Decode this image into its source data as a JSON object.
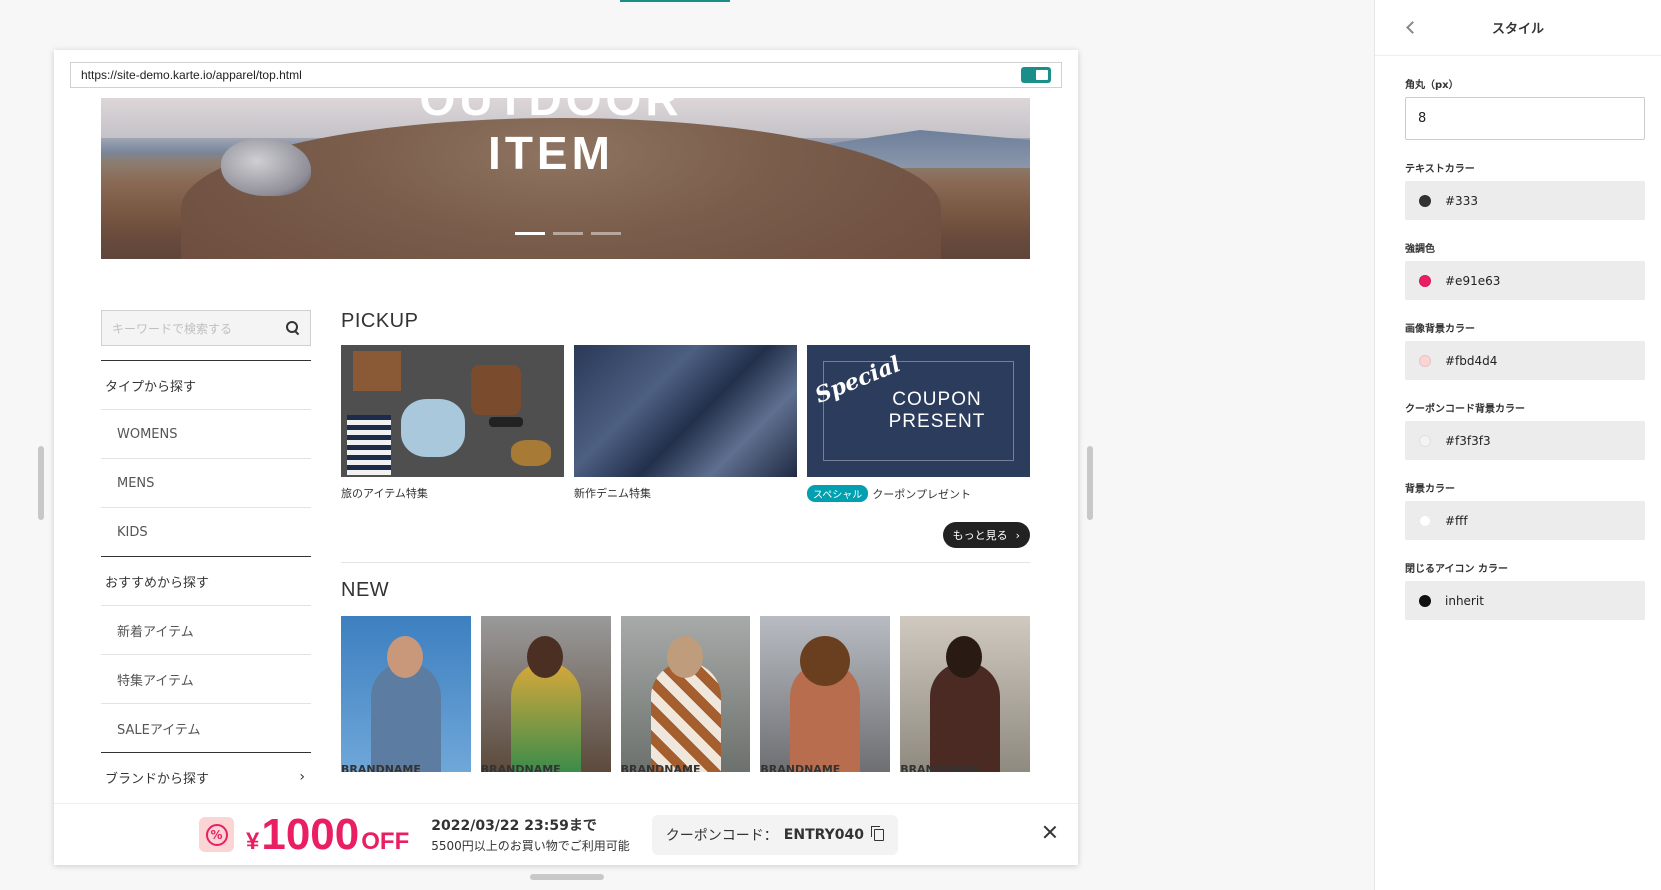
{
  "preview": {
    "url": "https://site-demo.karte.io/apparel/top.html",
    "hero_title": "OUTDOOR ITEM"
  },
  "sidebar": {
    "search_placeholder": "キーワードで検索する",
    "items": [
      {
        "label": "タイプから探す",
        "type": "head"
      },
      {
        "label": "WOMENS",
        "type": "sub"
      },
      {
        "label": "MENS",
        "type": "sub"
      },
      {
        "label": "KIDS",
        "type": "sub"
      },
      {
        "label": "おすすめから探す",
        "type": "head"
      },
      {
        "label": "新着アイテム",
        "type": "sub"
      },
      {
        "label": "特集アイテム",
        "type": "sub"
      },
      {
        "label": "SALEアイテム",
        "type": "sub"
      },
      {
        "label": "ブランドから探す",
        "type": "head"
      }
    ],
    "brand_chevron": "›"
  },
  "pickup": {
    "title": "PICKUP",
    "items": [
      {
        "caption": "旅のアイテム特集"
      },
      {
        "caption": "新作デニム特集"
      },
      {
        "badge": "スペシャル",
        "caption": "クーポンプレゼント",
        "image_script": "Special",
        "image_line1": "COUPON",
        "image_line2": "PRESENT"
      }
    ],
    "more_label": "もっと見る",
    "more_chevron": "›"
  },
  "new": {
    "title": "NEW",
    "brand_label": "BRANDNAME"
  },
  "coupon_bar": {
    "icon_glyph": "%",
    "currency": "¥",
    "amount": "1000",
    "off": "OFF",
    "deadline": "2022/03/22 23:59まで",
    "condition": "5500円以上のお買い物でご利用可能",
    "code_label": "クーポンコード：",
    "code": "ENTRY040"
  },
  "panel": {
    "title": "スタイル",
    "radius_label": "角丸（px）",
    "radius_value": "8",
    "colors": [
      {
        "label": "テキストカラー",
        "value": "#333",
        "swatch": "#333333"
      },
      {
        "label": "強調色",
        "value": "#e91e63",
        "swatch": "#e91e63"
      },
      {
        "label": "画像背景カラー",
        "value": "#fbd4d4",
        "swatch": "#fbd4d4"
      },
      {
        "label": "クーポンコード背景カラー",
        "value": "#f3f3f3",
        "swatch": "#f3f3f3"
      },
      {
        "label": "背景カラー",
        "value": "#fff",
        "swatch": "#ffffff"
      },
      {
        "label": "閉じるアイコン カラー",
        "value": "inherit",
        "swatch": "#111111"
      }
    ]
  }
}
